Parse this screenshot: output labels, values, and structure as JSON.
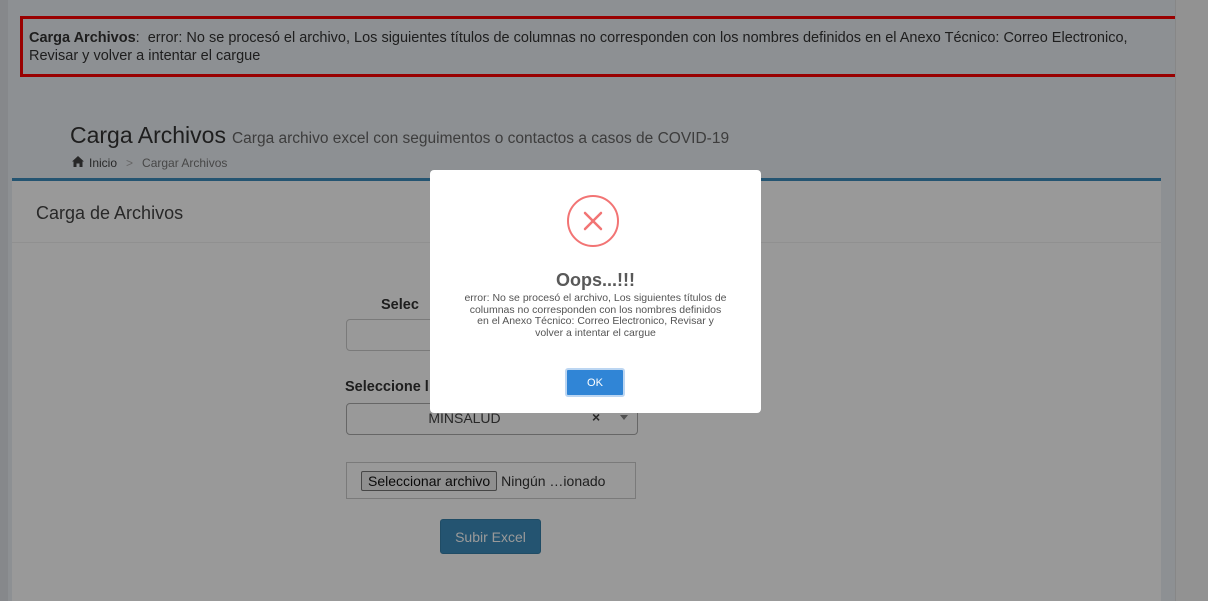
{
  "alert": {
    "title": "Carga Archivos",
    "message": "error: No se procesó el archivo, Los siguientes títulos de columnas no corresponden con los nombres definidos en el Anexo Técnico: Correo Electronico, Revisar y volver a intentar el cargue"
  },
  "header": {
    "title": "Carga Archivos",
    "subtitle": "Carga archivo excel con seguimentos o contactos a casos de COVID-19"
  },
  "breadcrumb": {
    "home": "Inicio",
    "separator": ">",
    "current": "Cargar Archivos"
  },
  "box": {
    "title": "Carga de Archivos"
  },
  "form": {
    "label_first": "Selec",
    "label_second": "Seleccione l",
    "select_value": "MINSALUD",
    "select_clear": "×",
    "file_button": "Seleccionar archivo",
    "file_status": "Ningún …ionado",
    "submit": "Subir Excel"
  },
  "modal": {
    "title": "Oops...!!!",
    "message": "error: No se procesó el archivo, Los siguientes títulos de columnas no corresponden con los nombres definidos en el Anexo Técnico: Correo Electronico, Revisar y volver a intentar el cargue",
    "ok": "OK"
  },
  "colors": {
    "accent": "#3c8dbc",
    "alert_border": "#ff0000",
    "error_icon": "#f27474",
    "ok_button": "#3085d6"
  }
}
